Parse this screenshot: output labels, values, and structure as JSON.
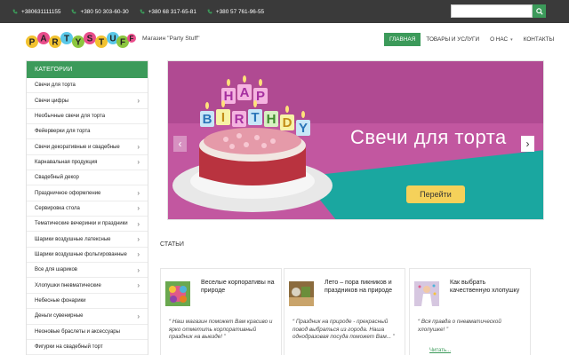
{
  "topbar": {
    "phones": [
      "+380631111155",
      "+380 50 303-60-30",
      "+380 68 317-65-81",
      "+380 57 761-96-55"
    ],
    "search_placeholder": ""
  },
  "header": {
    "logo_text": "PARTY STUFF",
    "tagline": "Магазин \"Party Stuff\"",
    "nav": [
      "Главная",
      "Товары и услуги",
      "О нас",
      "Контакты"
    ]
  },
  "sidebar": {
    "title": "Категории",
    "items": [
      {
        "label": "Свечи для торта",
        "has_children": false
      },
      {
        "label": "Свечи цифры",
        "has_children": true
      },
      {
        "label": "Необычные свечи для торта",
        "has_children": false
      },
      {
        "label": "Фейерверки для торта",
        "has_children": false
      },
      {
        "label": "Свечи декоративные и свадебные",
        "has_children": true
      },
      {
        "label": "Карнавальная продукция",
        "has_children": true
      },
      {
        "label": "Свадебный декор",
        "has_children": false
      },
      {
        "label": "Праздничное оформление",
        "has_children": true
      },
      {
        "label": "Сервировка стола",
        "has_children": true
      },
      {
        "label": "Тематические вечеринки и праздники",
        "has_children": true
      },
      {
        "label": "Шарики воздушные латексные",
        "has_children": true
      },
      {
        "label": "Шарики воздушные фольгированные",
        "has_children": true
      },
      {
        "label": "Все для шариков",
        "has_children": true
      },
      {
        "label": "Хлопушки пневматические",
        "has_children": true
      },
      {
        "label": "Небесные фонарики",
        "has_children": false
      },
      {
        "label": "Деньги сувенирные",
        "has_children": true
      },
      {
        "label": "Неоновые браслеты и аксессуары",
        "has_children": false
      },
      {
        "label": "Фигурки на свадебный торт",
        "has_children": false
      }
    ]
  },
  "slider": {
    "title": "Свечи для торта",
    "button": "Перейти",
    "candle_letters": "HAPPY BIRTHDAY"
  },
  "articles": {
    "section_title": "Статьи",
    "cards": [
      {
        "title": "Веселые корпоративы на природе",
        "quote": "“ Наш магазин поможет Вам красиво и ярко отметить корпоративный праздник на выезде! ”"
      },
      {
        "title": "Лето – пора пикников и праздников на природе",
        "quote": "“ Праздник на природе - прекрасный повод выбраться из города. Наша однодразовая посуда поможет Вам... ”"
      },
      {
        "title": "Как выбрать качественную хлопушку",
        "quote": "“ Вся правда о пневматической хлопушке! ”",
        "more": "Читать..."
      }
    ]
  },
  "colors": {
    "accent": "#3c9a5a",
    "topbar": "#3a3a3a",
    "slide_bg": "#c257a0",
    "slide_teal": "#1aa7a0",
    "button_yellow": "#f5d15a"
  }
}
